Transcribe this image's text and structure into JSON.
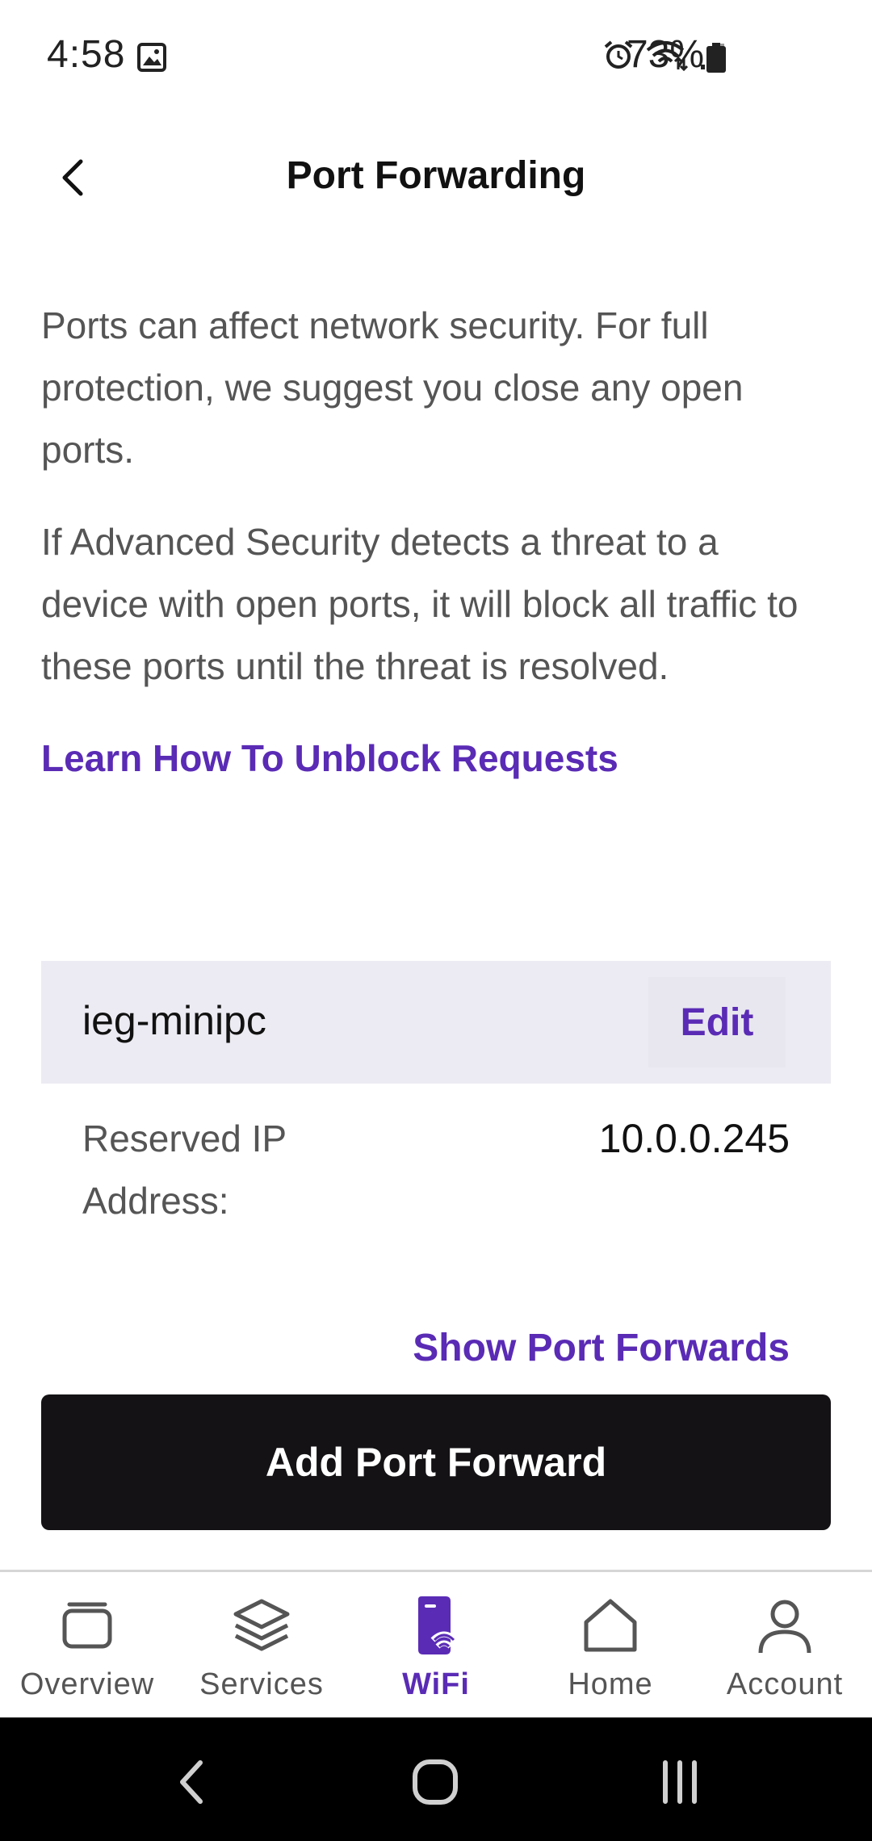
{
  "status_bar": {
    "time": "4:58",
    "battery_percent": "73%",
    "icons": [
      "gallery-icon",
      "alarm-icon",
      "wifi-icon",
      "signal-icon",
      "battery-icon"
    ]
  },
  "header": {
    "title": "Port Forwarding",
    "back_icon": "chevron-left-icon"
  },
  "content": {
    "paragraph_1": "Ports can affect network security. For full protection, we suggest you close any open ports.",
    "paragraph_2": "If Advanced Security detects a threat to a device with open ports, it will block all traffic to these ports until the threat is resolved.",
    "learn_link": "Learn How To Unblock Requests"
  },
  "device": {
    "name": "ieg-minipc",
    "edit_label": "Edit",
    "ip_label": "Reserved IP Address:",
    "ip_value": "10.0.0.245",
    "show_forwards_label": "Show Port Forwards"
  },
  "primary_action": {
    "label": "Add Port Forward"
  },
  "bottom_nav": {
    "items": [
      {
        "label": "Overview",
        "icon": "overview-icon",
        "active": false
      },
      {
        "label": "Services",
        "icon": "layers-icon",
        "active": false
      },
      {
        "label": "WiFi",
        "icon": "wifi-router-icon",
        "active": true
      },
      {
        "label": "Home",
        "icon": "home-icon",
        "active": false
      },
      {
        "label": "Account",
        "icon": "account-icon",
        "active": false
      }
    ]
  },
  "colors": {
    "accent": "#5a2bb5",
    "primary_button": "#141214",
    "card_header": "#ecebf3"
  }
}
